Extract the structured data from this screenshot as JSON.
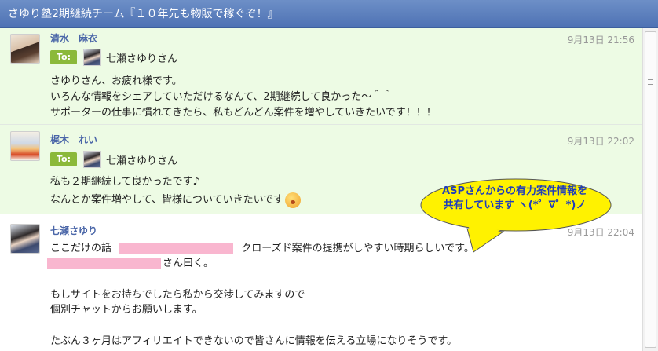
{
  "window": {
    "title": "さゆり塾2期継続チーム『１０年先も物販で稼ぐぞ！』"
  },
  "to_label": "To:",
  "messages": [
    {
      "sender": "清水　麻衣",
      "time": "9月13日 21:56",
      "to": "七瀬さゆりさん",
      "lines": [
        "さゆりさん、お疲れ様です。",
        "いろんな情報をシェアしていただけるなんて、2期継続して良かった～＾＾",
        "サポーターの仕事に慣れてきたら、私もどんどん案件を増やしていきたいです！！！"
      ]
    },
    {
      "sender": "梶木　れい",
      "time": "9月13日 22:02",
      "to": "七瀬さゆりさん",
      "lines": [
        "私も２期継続して良かったです♪",
        "なんとか案件増やして、皆様についていきたいです"
      ]
    },
    {
      "sender": "七瀬さゆり",
      "time": "9月13日 22:04",
      "lines": [
        "ここだけの話",
        "クローズド案件の提携がしやすい時期らしいです。",
        "さん曰く。",
        "もしサイトをお持ちでしたら私から交渉してみますので",
        "個別チャットからお願いします。",
        "たぶん３ヶ月はアフィリエイトできないので皆さんに情報を伝える立場になりそうです。"
      ]
    }
  ],
  "callout": {
    "text": "ASPさんからの有力案件情報を\n共有しています ヽ(*゜∇゜*)ノ",
    "fill": "#fff200",
    "text_color": "#1f3dbb"
  },
  "colors": {
    "titlebar": "#4e72b4",
    "message_bg": "#edfbe4",
    "redaction": "#f9b6cf",
    "to_badge": "#8bb93a",
    "sender": "#4a66a8"
  }
}
